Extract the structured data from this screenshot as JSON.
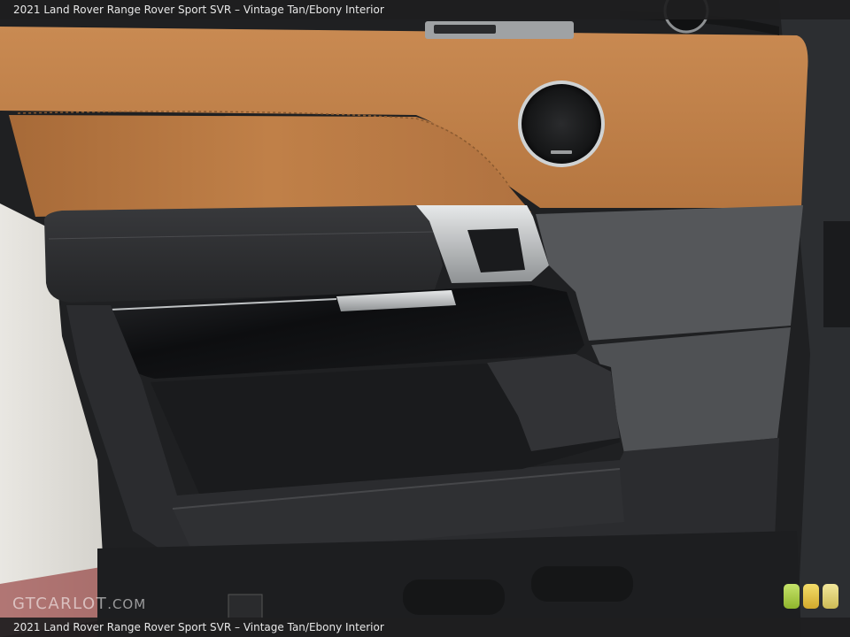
{
  "caption": {
    "title": "2021 Land Rover Range Rover Sport SVR – Vintage Tan/Ebony Interior"
  },
  "watermark": {
    "brand_main": "GTCARLOT",
    "brand_tail": ".COM"
  },
  "palette": {
    "tan_leather": "#b87a45",
    "ebony": "#2a2b2e",
    "trim_chrome": "#bfc2c4",
    "gloss_black": "#111214"
  },
  "icons": {
    "badge": "color-rating-badges"
  }
}
